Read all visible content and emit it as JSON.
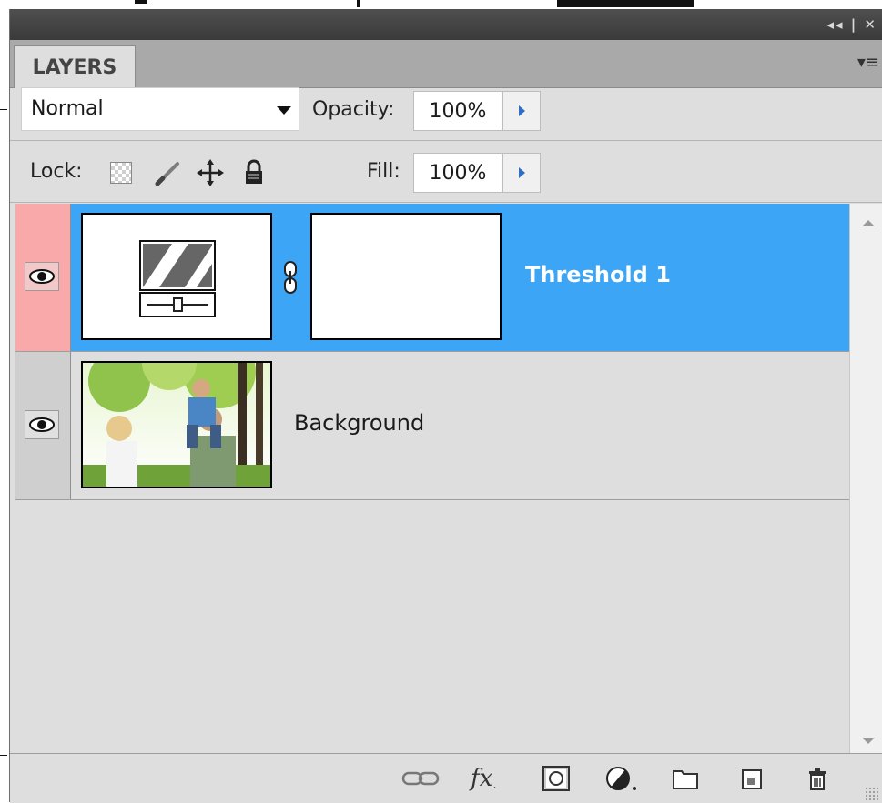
{
  "panel": {
    "tab_label": "LAYERS",
    "titlebar_controls": "◂◂ | ✕",
    "menu_icon": "panel-menu-icon"
  },
  "blend": {
    "mode": "Normal",
    "opacity_label": "Opacity:",
    "opacity_value": "100%",
    "lock_label": "Lock:",
    "fill_label": "Fill:",
    "fill_value": "100%"
  },
  "layers": [
    {
      "name": "Threshold 1",
      "selected": true,
      "visible": true,
      "type": "adjustment",
      "has_mask": true
    },
    {
      "name": "Background",
      "selected": false,
      "visible": true,
      "type": "image"
    }
  ],
  "lock_icons": [
    "lock-transparent-pixels-icon",
    "lock-image-pixels-icon",
    "lock-position-icon",
    "lock-all-icon"
  ],
  "footer_icons": [
    "link-layers-icon",
    "fx-icon",
    "add-mask-icon",
    "adjustment-layer-icon",
    "group-icon",
    "new-layer-icon",
    "trash-icon"
  ],
  "colors": {
    "selection": "#3da5f6",
    "visibility_selected": "#f9a9a9",
    "panel_bg": "#dedede"
  }
}
